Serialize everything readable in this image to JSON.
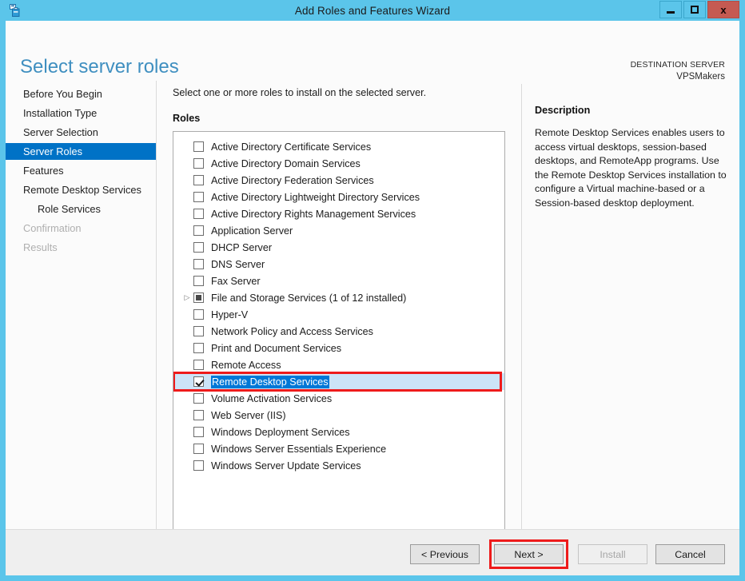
{
  "window": {
    "title": "Add Roles and Features Wizard",
    "app_icon": "server-roles-icon",
    "minimize_label": "Minimize",
    "maximize_label": "Maximize",
    "close_label": "x",
    "frame_color": "#5BC5EA",
    "close_color": "#C55A52"
  },
  "header": {
    "page_title": "Select server roles",
    "destination_label": "DESTINATION SERVER",
    "destination_server": "VPSMakers",
    "title_color": "#3F8FC0"
  },
  "sidebar": {
    "selected_color": "#0072C6",
    "items": [
      {
        "label": "Before You Begin",
        "state": "normal",
        "sub": false
      },
      {
        "label": "Installation Type",
        "state": "normal",
        "sub": false
      },
      {
        "label": "Server Selection",
        "state": "normal",
        "sub": false
      },
      {
        "label": "Server Roles",
        "state": "selected",
        "sub": false
      },
      {
        "label": "Features",
        "state": "normal",
        "sub": false
      },
      {
        "label": "Remote Desktop Services",
        "state": "normal",
        "sub": false
      },
      {
        "label": "Role Services",
        "state": "normal",
        "sub": true
      },
      {
        "label": "Confirmation",
        "state": "disabled",
        "sub": false
      },
      {
        "label": "Results",
        "state": "disabled",
        "sub": false
      }
    ]
  },
  "main": {
    "intro_text": "Select one or more roles to install on the selected server.",
    "roles_caption": "Roles",
    "selection_highlight_color": "#0078D7",
    "selected_row_bg": "#CCE4F7",
    "annotation_color": "#EE1B1B",
    "roles": [
      {
        "label": "Active Directory Certificate Services",
        "checked": false,
        "partial": false,
        "expandable": false,
        "selected": false
      },
      {
        "label": "Active Directory Domain Services",
        "checked": false,
        "partial": false,
        "expandable": false,
        "selected": false
      },
      {
        "label": "Active Directory Federation Services",
        "checked": false,
        "partial": false,
        "expandable": false,
        "selected": false
      },
      {
        "label": "Active Directory Lightweight Directory Services",
        "checked": false,
        "partial": false,
        "expandable": false,
        "selected": false
      },
      {
        "label": "Active Directory Rights Management Services",
        "checked": false,
        "partial": false,
        "expandable": false,
        "selected": false
      },
      {
        "label": "Application Server",
        "checked": false,
        "partial": false,
        "expandable": false,
        "selected": false
      },
      {
        "label": "DHCP Server",
        "checked": false,
        "partial": false,
        "expandable": false,
        "selected": false
      },
      {
        "label": "DNS Server",
        "checked": false,
        "partial": false,
        "expandable": false,
        "selected": false
      },
      {
        "label": "Fax Server",
        "checked": false,
        "partial": false,
        "expandable": false,
        "selected": false
      },
      {
        "label": "File and Storage Services (1 of 12 installed)",
        "checked": false,
        "partial": true,
        "expandable": true,
        "selected": false
      },
      {
        "label": "Hyper-V",
        "checked": false,
        "partial": false,
        "expandable": false,
        "selected": false
      },
      {
        "label": "Network Policy and Access Services",
        "checked": false,
        "partial": false,
        "expandable": false,
        "selected": false
      },
      {
        "label": "Print and Document Services",
        "checked": false,
        "partial": false,
        "expandable": false,
        "selected": false
      },
      {
        "label": "Remote Access",
        "checked": false,
        "partial": false,
        "expandable": false,
        "selected": false
      },
      {
        "label": "Remote Desktop Services",
        "checked": true,
        "partial": false,
        "expandable": false,
        "selected": true
      },
      {
        "label": "Volume Activation Services",
        "checked": false,
        "partial": false,
        "expandable": false,
        "selected": false
      },
      {
        "label": "Web Server (IIS)",
        "checked": false,
        "partial": false,
        "expandable": false,
        "selected": false
      },
      {
        "label": "Windows Deployment Services",
        "checked": false,
        "partial": false,
        "expandable": false,
        "selected": false
      },
      {
        "label": "Windows Server Essentials Experience",
        "checked": false,
        "partial": false,
        "expandable": false,
        "selected": false
      },
      {
        "label": "Windows Server Update Services",
        "checked": false,
        "partial": false,
        "expandable": false,
        "selected": false
      }
    ]
  },
  "description": {
    "title": "Description",
    "body": "Remote Desktop Services enables users to access virtual desktops, session-based desktops, and RemoteApp programs. Use the Remote Desktop Services installation to configure a Virtual machine-based or a Session-based desktop deployment."
  },
  "footer": {
    "previous_label": "< Previous",
    "next_label": "Next >",
    "install_label": "Install",
    "cancel_label": "Cancel",
    "install_disabled": true,
    "next_highlighted": true
  }
}
